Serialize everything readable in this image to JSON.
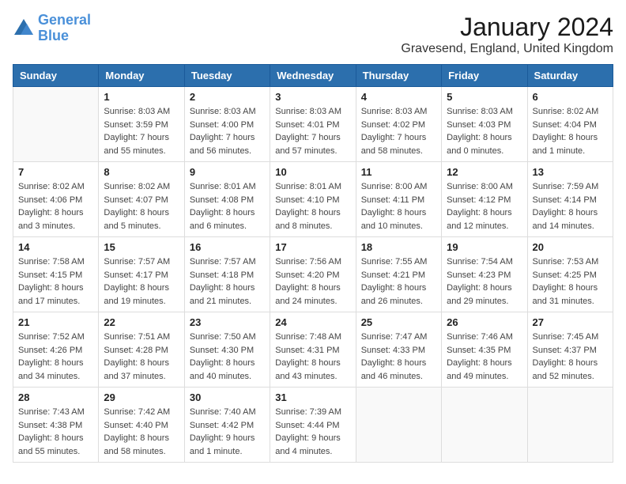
{
  "header": {
    "logo_line1": "General",
    "logo_line2": "Blue",
    "title": "January 2024",
    "subtitle": "Gravesend, England, United Kingdom"
  },
  "calendar": {
    "days_of_week": [
      "Sunday",
      "Monday",
      "Tuesday",
      "Wednesday",
      "Thursday",
      "Friday",
      "Saturday"
    ],
    "weeks": [
      [
        {
          "day": "",
          "info": ""
        },
        {
          "day": "1",
          "info": "Sunrise: 8:03 AM\nSunset: 3:59 PM\nDaylight: 7 hours\nand 55 minutes."
        },
        {
          "day": "2",
          "info": "Sunrise: 8:03 AM\nSunset: 4:00 PM\nDaylight: 7 hours\nand 56 minutes."
        },
        {
          "day": "3",
          "info": "Sunrise: 8:03 AM\nSunset: 4:01 PM\nDaylight: 7 hours\nand 57 minutes."
        },
        {
          "day": "4",
          "info": "Sunrise: 8:03 AM\nSunset: 4:02 PM\nDaylight: 7 hours\nand 58 minutes."
        },
        {
          "day": "5",
          "info": "Sunrise: 8:03 AM\nSunset: 4:03 PM\nDaylight: 8 hours\nand 0 minutes."
        },
        {
          "day": "6",
          "info": "Sunrise: 8:02 AM\nSunset: 4:04 PM\nDaylight: 8 hours\nand 1 minute."
        }
      ],
      [
        {
          "day": "7",
          "info": "Sunrise: 8:02 AM\nSunset: 4:06 PM\nDaylight: 8 hours\nand 3 minutes."
        },
        {
          "day": "8",
          "info": "Sunrise: 8:02 AM\nSunset: 4:07 PM\nDaylight: 8 hours\nand 5 minutes."
        },
        {
          "day": "9",
          "info": "Sunrise: 8:01 AM\nSunset: 4:08 PM\nDaylight: 8 hours\nand 6 minutes."
        },
        {
          "day": "10",
          "info": "Sunrise: 8:01 AM\nSunset: 4:10 PM\nDaylight: 8 hours\nand 8 minutes."
        },
        {
          "day": "11",
          "info": "Sunrise: 8:00 AM\nSunset: 4:11 PM\nDaylight: 8 hours\nand 10 minutes."
        },
        {
          "day": "12",
          "info": "Sunrise: 8:00 AM\nSunset: 4:12 PM\nDaylight: 8 hours\nand 12 minutes."
        },
        {
          "day": "13",
          "info": "Sunrise: 7:59 AM\nSunset: 4:14 PM\nDaylight: 8 hours\nand 14 minutes."
        }
      ],
      [
        {
          "day": "14",
          "info": "Sunrise: 7:58 AM\nSunset: 4:15 PM\nDaylight: 8 hours\nand 17 minutes."
        },
        {
          "day": "15",
          "info": "Sunrise: 7:57 AM\nSunset: 4:17 PM\nDaylight: 8 hours\nand 19 minutes."
        },
        {
          "day": "16",
          "info": "Sunrise: 7:57 AM\nSunset: 4:18 PM\nDaylight: 8 hours\nand 21 minutes."
        },
        {
          "day": "17",
          "info": "Sunrise: 7:56 AM\nSunset: 4:20 PM\nDaylight: 8 hours\nand 24 minutes."
        },
        {
          "day": "18",
          "info": "Sunrise: 7:55 AM\nSunset: 4:21 PM\nDaylight: 8 hours\nand 26 minutes."
        },
        {
          "day": "19",
          "info": "Sunrise: 7:54 AM\nSunset: 4:23 PM\nDaylight: 8 hours\nand 29 minutes."
        },
        {
          "day": "20",
          "info": "Sunrise: 7:53 AM\nSunset: 4:25 PM\nDaylight: 8 hours\nand 31 minutes."
        }
      ],
      [
        {
          "day": "21",
          "info": "Sunrise: 7:52 AM\nSunset: 4:26 PM\nDaylight: 8 hours\nand 34 minutes."
        },
        {
          "day": "22",
          "info": "Sunrise: 7:51 AM\nSunset: 4:28 PM\nDaylight: 8 hours\nand 37 minutes."
        },
        {
          "day": "23",
          "info": "Sunrise: 7:50 AM\nSunset: 4:30 PM\nDaylight: 8 hours\nand 40 minutes."
        },
        {
          "day": "24",
          "info": "Sunrise: 7:48 AM\nSunset: 4:31 PM\nDaylight: 8 hours\nand 43 minutes."
        },
        {
          "day": "25",
          "info": "Sunrise: 7:47 AM\nSunset: 4:33 PM\nDaylight: 8 hours\nand 46 minutes."
        },
        {
          "day": "26",
          "info": "Sunrise: 7:46 AM\nSunset: 4:35 PM\nDaylight: 8 hours\nand 49 minutes."
        },
        {
          "day": "27",
          "info": "Sunrise: 7:45 AM\nSunset: 4:37 PM\nDaylight: 8 hours\nand 52 minutes."
        }
      ],
      [
        {
          "day": "28",
          "info": "Sunrise: 7:43 AM\nSunset: 4:38 PM\nDaylight: 8 hours\nand 55 minutes."
        },
        {
          "day": "29",
          "info": "Sunrise: 7:42 AM\nSunset: 4:40 PM\nDaylight: 8 hours\nand 58 minutes."
        },
        {
          "day": "30",
          "info": "Sunrise: 7:40 AM\nSunset: 4:42 PM\nDaylight: 9 hours\nand 1 minute."
        },
        {
          "day": "31",
          "info": "Sunrise: 7:39 AM\nSunset: 4:44 PM\nDaylight: 9 hours\nand 4 minutes."
        },
        {
          "day": "",
          "info": ""
        },
        {
          "day": "",
          "info": ""
        },
        {
          "day": "",
          "info": ""
        }
      ]
    ]
  }
}
